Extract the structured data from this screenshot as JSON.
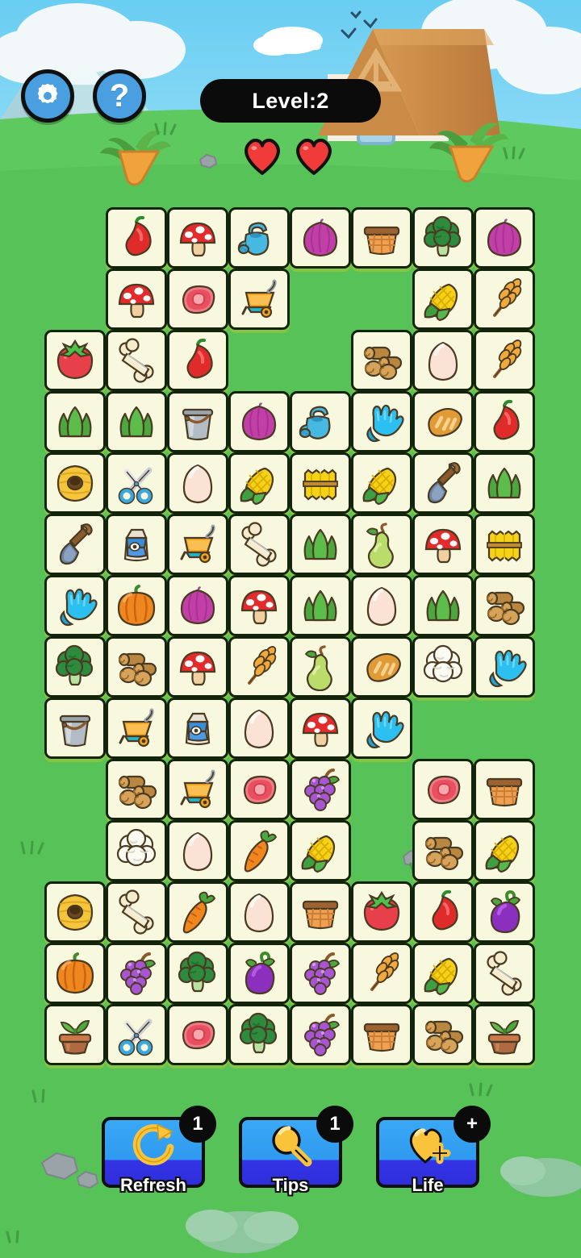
{
  "colors": {
    "sky": "#62c8ef",
    "grass": "#5ec95e",
    "grass_dark": "#4cb94c",
    "tile_face": "#f8f8df",
    "tile_border": "#14240c",
    "tile_shadow": "#86c544",
    "button_blue": "#3aa8f5",
    "button_blue_dark": "#2e2edb",
    "accent_yellow": "#f9c43c",
    "heart_red": "#f03b3b",
    "badge_black": "#0b0b0b",
    "pill_black": "#0b0b0b"
  },
  "header": {
    "settings_icon": "gear-icon",
    "help_icon": "question-mark-icon",
    "level_label": "Level:2",
    "lives": 2,
    "life_icon": "heart-icon"
  },
  "scene": {
    "house_icon": "house-icon",
    "mountain_icon": "mountain-icon",
    "cloud_icon": "cloud-icon",
    "bird_icon": "bird-icon",
    "carrot_plant_icon": "carrot-plant-icon",
    "rock_icon": "rock-icon",
    "bush_icon": "bush-icon"
  },
  "board": {
    "columns": 8,
    "rows": 14,
    "cell_size": 76,
    "tiles": [
      [
        null,
        "chili",
        "mushroom",
        "watering-can",
        "onion",
        "basket",
        "broccoli",
        "onion"
      ],
      [
        null,
        "mushroom",
        "meat",
        "wheelbarrow",
        null,
        null,
        "corn",
        "wheat"
      ],
      [
        "tomato",
        "bone",
        "chili",
        null,
        null,
        "logs",
        "egg",
        "wheat"
      ],
      [
        "grass",
        "grass",
        "bucket",
        "onion",
        "watering-can",
        "glove",
        "bread",
        "chili"
      ],
      [
        "beehive",
        "scissors",
        "egg",
        "corn",
        "haybale",
        "corn",
        "shovel",
        "grass"
      ],
      [
        "shovel",
        "milk",
        "wheelbarrow",
        "bone",
        "grass",
        "pear",
        "mushroom",
        "haybale"
      ],
      [
        "glove",
        "pumpkin",
        "onion",
        "mushroom",
        "grass",
        "egg",
        "grass",
        "logs"
      ],
      [
        "broccoli",
        "logs",
        "mushroom",
        "wheat",
        "pear",
        "bread",
        "cauliflower",
        "glove"
      ],
      [
        "bucket",
        "wheelbarrow",
        "milk",
        "egg",
        "mushroom",
        "glove",
        null,
        null
      ],
      [
        null,
        "logs",
        "wheelbarrow",
        "meat",
        "grapes",
        null,
        "meat",
        "basket"
      ],
      [
        null,
        "cauliflower",
        "egg",
        "carrot",
        "corn",
        null,
        "logs",
        "corn"
      ],
      [
        "beehive",
        "bone",
        "carrot",
        "egg",
        "basket",
        "tomato",
        "chili",
        "eggplant"
      ],
      [
        "pumpkin",
        "grapes",
        "broccoli",
        "eggplant",
        "grapes",
        "wheat",
        "corn",
        "bone"
      ],
      [
        "potted-plant",
        "scissors",
        "meat",
        "broccoli",
        "grapes",
        "basket",
        "logs",
        "potted-plant"
      ]
    ]
  },
  "actions": [
    {
      "id": "refresh",
      "label": "Refresh",
      "icon": "refresh-icon",
      "badge": "1"
    },
    {
      "id": "tips",
      "label": "Tips",
      "icon": "magnifier-icon",
      "badge": "1"
    },
    {
      "id": "life",
      "label": "Life",
      "icon": "heart-plus-icon",
      "badge": "+"
    }
  ]
}
